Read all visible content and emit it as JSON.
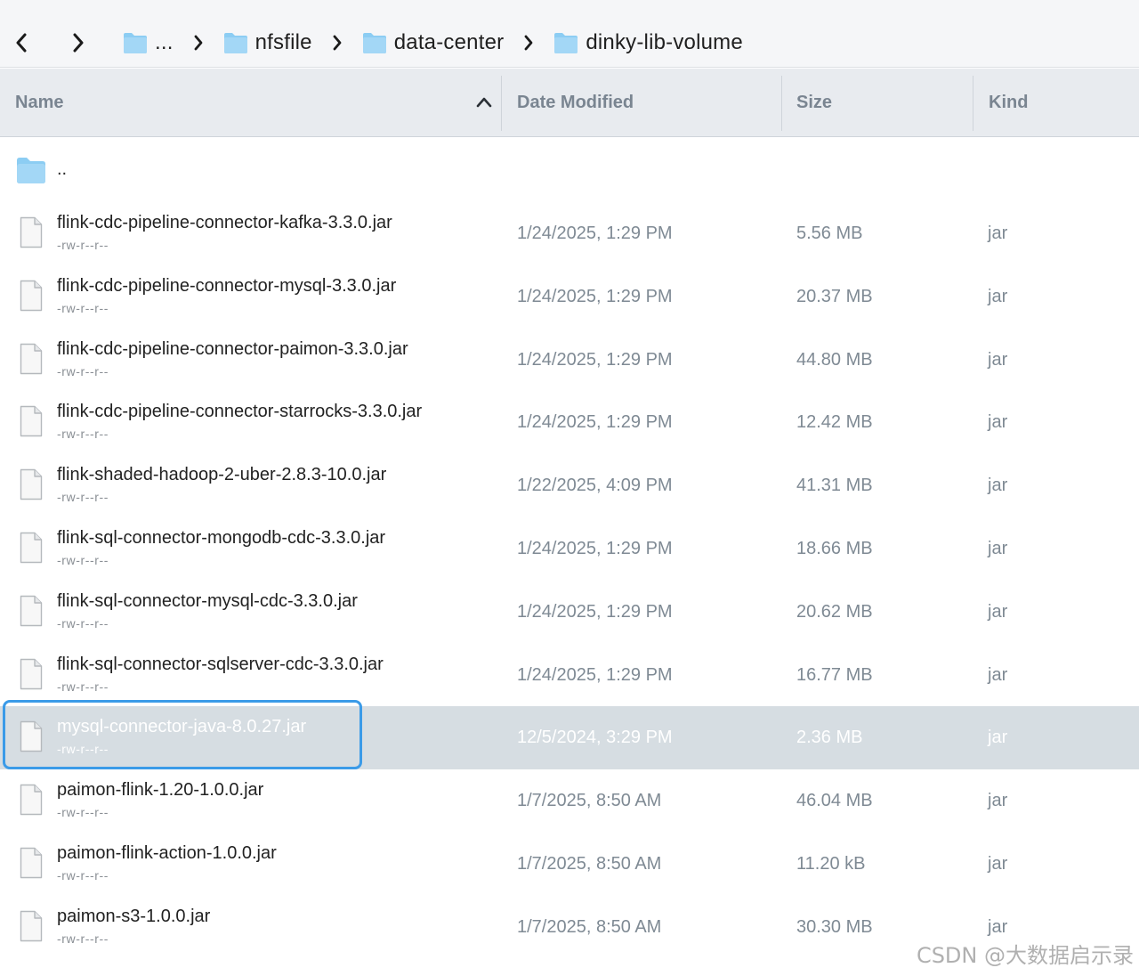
{
  "toolbar": {
    "back_icon": "chevron-left-icon",
    "forward_icon": "chevron-right-icon",
    "breadcrumb": [
      {
        "label": "..."
      },
      {
        "label": "nfsfile"
      },
      {
        "label": "data-center"
      },
      {
        "label": "dinky-lib-volume"
      }
    ]
  },
  "columns": {
    "name": "Name",
    "date": "Date Modified",
    "size": "Size",
    "kind": "Kind",
    "sort": "ascending"
  },
  "parent": {
    "label": ".."
  },
  "files": [
    {
      "name": "flink-cdc-pipeline-connector-kafka-3.3.0.jar",
      "perm": "-rw-r--r--",
      "date": "1/24/2025, 1:29 PM",
      "size": "5.56 MB",
      "kind": "jar"
    },
    {
      "name": "flink-cdc-pipeline-connector-mysql-3.3.0.jar",
      "perm": "-rw-r--r--",
      "date": "1/24/2025, 1:29 PM",
      "size": "20.37 MB",
      "kind": "jar"
    },
    {
      "name": "flink-cdc-pipeline-connector-paimon-3.3.0.jar",
      "perm": "-rw-r--r--",
      "date": "1/24/2025, 1:29 PM",
      "size": "44.80 MB",
      "kind": "jar"
    },
    {
      "name": "flink-cdc-pipeline-connector-starrocks-3.3.0.jar",
      "perm": "-rw-r--r--",
      "date": "1/24/2025, 1:29 PM",
      "size": "12.42 MB",
      "kind": "jar"
    },
    {
      "name": "flink-shaded-hadoop-2-uber-2.8.3-10.0.jar",
      "perm": "-rw-r--r--",
      "date": "1/22/2025, 4:09 PM",
      "size": "41.31 MB",
      "kind": "jar"
    },
    {
      "name": "flink-sql-connector-mongodb-cdc-3.3.0.jar",
      "perm": "-rw-r--r--",
      "date": "1/24/2025, 1:29 PM",
      "size": "18.66 MB",
      "kind": "jar"
    },
    {
      "name": "flink-sql-connector-mysql-cdc-3.3.0.jar",
      "perm": "-rw-r--r--",
      "date": "1/24/2025, 1:29 PM",
      "size": "20.62 MB",
      "kind": "jar"
    },
    {
      "name": "flink-sql-connector-sqlserver-cdc-3.3.0.jar",
      "perm": "-rw-r--r--",
      "date": "1/24/2025, 1:29 PM",
      "size": "16.77 MB",
      "kind": "jar"
    },
    {
      "name": "mysql-connector-java-8.0.27.jar",
      "perm": "-rw-r--r--",
      "date": "12/5/2024, 3:29 PM",
      "size": "2.36 MB",
      "kind": "jar",
      "selected": true
    },
    {
      "name": "paimon-flink-1.20-1.0.0.jar",
      "perm": "-rw-r--r--",
      "date": "1/7/2025, 8:50 AM",
      "size": "46.04 MB",
      "kind": "jar"
    },
    {
      "name": "paimon-flink-action-1.0.0.jar",
      "perm": "-rw-r--r--",
      "date": "1/7/2025, 8:50 AM",
      "size": "11.20 kB",
      "kind": "jar"
    },
    {
      "name": "paimon-s3-1.0.0.jar",
      "perm": "-rw-r--r--",
      "date": "1/7/2025, 8:50 AM",
      "size": "30.30 MB",
      "kind": "jar"
    }
  ],
  "watermark": "CSDN @大数据启示录",
  "colors": {
    "folder": "#8ccdf3",
    "selected_row": "#d6dde2",
    "focus_ring": "#3b9be8",
    "header_bg": "#e8ebef"
  }
}
